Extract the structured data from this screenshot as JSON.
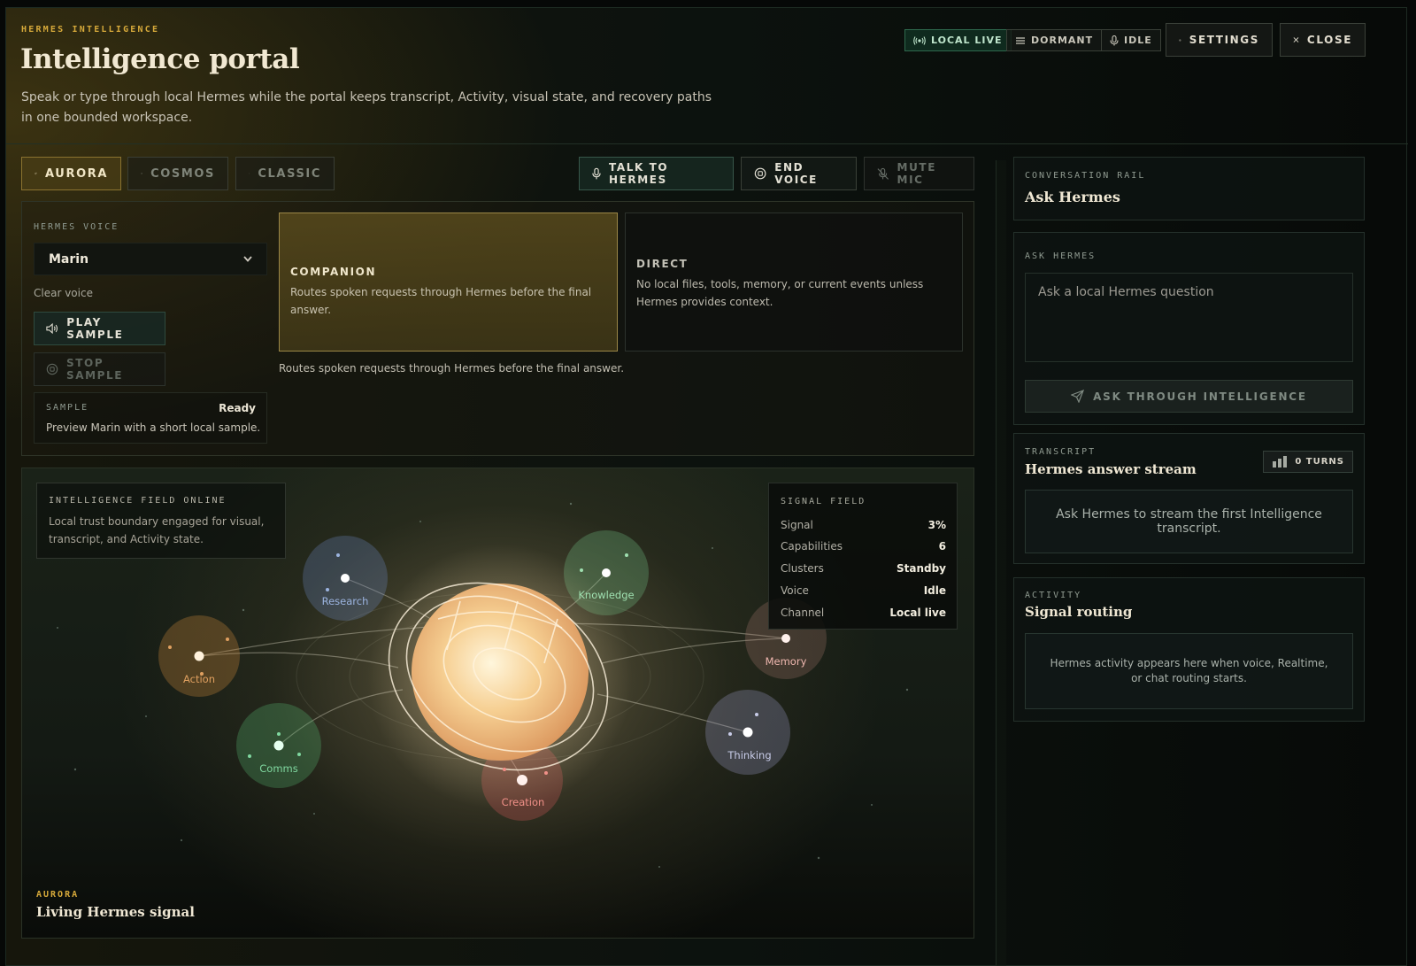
{
  "header": {
    "eyebrow": "HERMES INTELLIGENCE",
    "title": "Intelligence portal",
    "description": "Speak or type through local Hermes while the portal keeps transcript, Activity, visual state, and recovery paths in one bounded workspace.",
    "chips": [
      {
        "label": "LOCAL LIVE",
        "icon": "broadcast-icon"
      },
      {
        "label": "DORMANT",
        "icon": "list-icon"
      },
      {
        "label": "IDLE",
        "icon": "mic-icon"
      }
    ],
    "settings_label": "SETTINGS",
    "close_label": "CLOSE"
  },
  "visual_tabs": [
    {
      "label": "AURORA",
      "icon": "sparkle-icon",
      "active": true
    },
    {
      "label": "COSMOS",
      "icon": "orbit-icon",
      "active": false
    },
    {
      "label": "CLASSIC",
      "icon": "brain-icon",
      "active": false
    }
  ],
  "voice_controls": {
    "talk_label": "TALK TO HERMES",
    "end_label": "END VOICE",
    "mute_label": "MUTE MIC"
  },
  "voice_panel": {
    "label": "HERMES VOICE",
    "selected_voice": "Marin",
    "voice_note": "Clear voice",
    "play_label": "PLAY SAMPLE",
    "stop_label": "STOP SAMPLE",
    "sample": {
      "label": "SAMPLE",
      "status": "Ready",
      "description": "Preview Marin with a short local sample."
    },
    "modes": [
      {
        "title": "COMPANION",
        "description": "Routes spoken requests through Hermes before the final answer.",
        "active": true
      },
      {
        "title": "DIRECT",
        "description": "No local files, tools, memory, or current events unless Hermes provides context.",
        "active": false
      }
    ],
    "mode_helper": "Routes spoken requests through Hermes before the final answer."
  },
  "aurora": {
    "field_title": "INTELLIGENCE FIELD ONLINE",
    "field_description": "Local trust boundary engaged for visual, transcript, and Activity state.",
    "signal_field": {
      "title": "SIGNAL FIELD",
      "rows": [
        {
          "key": "Signal",
          "value": "3%"
        },
        {
          "key": "Capabilities",
          "value": "6"
        },
        {
          "key": "Clusters",
          "value": "Standby"
        },
        {
          "key": "Voice",
          "value": "Idle"
        },
        {
          "key": "Channel",
          "value": "Local live"
        }
      ]
    },
    "nodes": [
      {
        "label": "Research",
        "color": "#9cb4e0"
      },
      {
        "label": "Knowledge",
        "color": "#9fe0b0"
      },
      {
        "label": "Action",
        "color": "#e0a060"
      },
      {
        "label": "Memory",
        "color": "#f0b8b0"
      },
      {
        "label": "Comms",
        "color": "#80d8a0"
      },
      {
        "label": "Thinking",
        "color": "#c8cce8"
      },
      {
        "label": "Creation",
        "color": "#f09088"
      }
    ],
    "eyebrow": "AURORA",
    "title": "Living Hermes signal"
  },
  "rail": {
    "conversation": {
      "eyebrow": "CONVERSATION RAIL",
      "title": "Ask Hermes"
    },
    "ask": {
      "eyebrow": "ASK HERMES",
      "placeholder": "Ask a local Hermes question",
      "button_label": "ASK THROUGH INTELLIGENCE"
    },
    "transcript": {
      "eyebrow": "TRANSCRIPT",
      "title": "Hermes answer stream",
      "turns_label": "0 TURNS",
      "empty": "Ask Hermes to stream the first Intelligence transcript."
    },
    "activity": {
      "eyebrow": "ACTIVITY",
      "title": "Signal routing",
      "empty": "Hermes activity appears here when voice, Realtime, or chat routing starts."
    }
  },
  "colors": {
    "accent_gold": "#d6a93a",
    "live_green": "#2f6a4e",
    "background": "#060807"
  }
}
